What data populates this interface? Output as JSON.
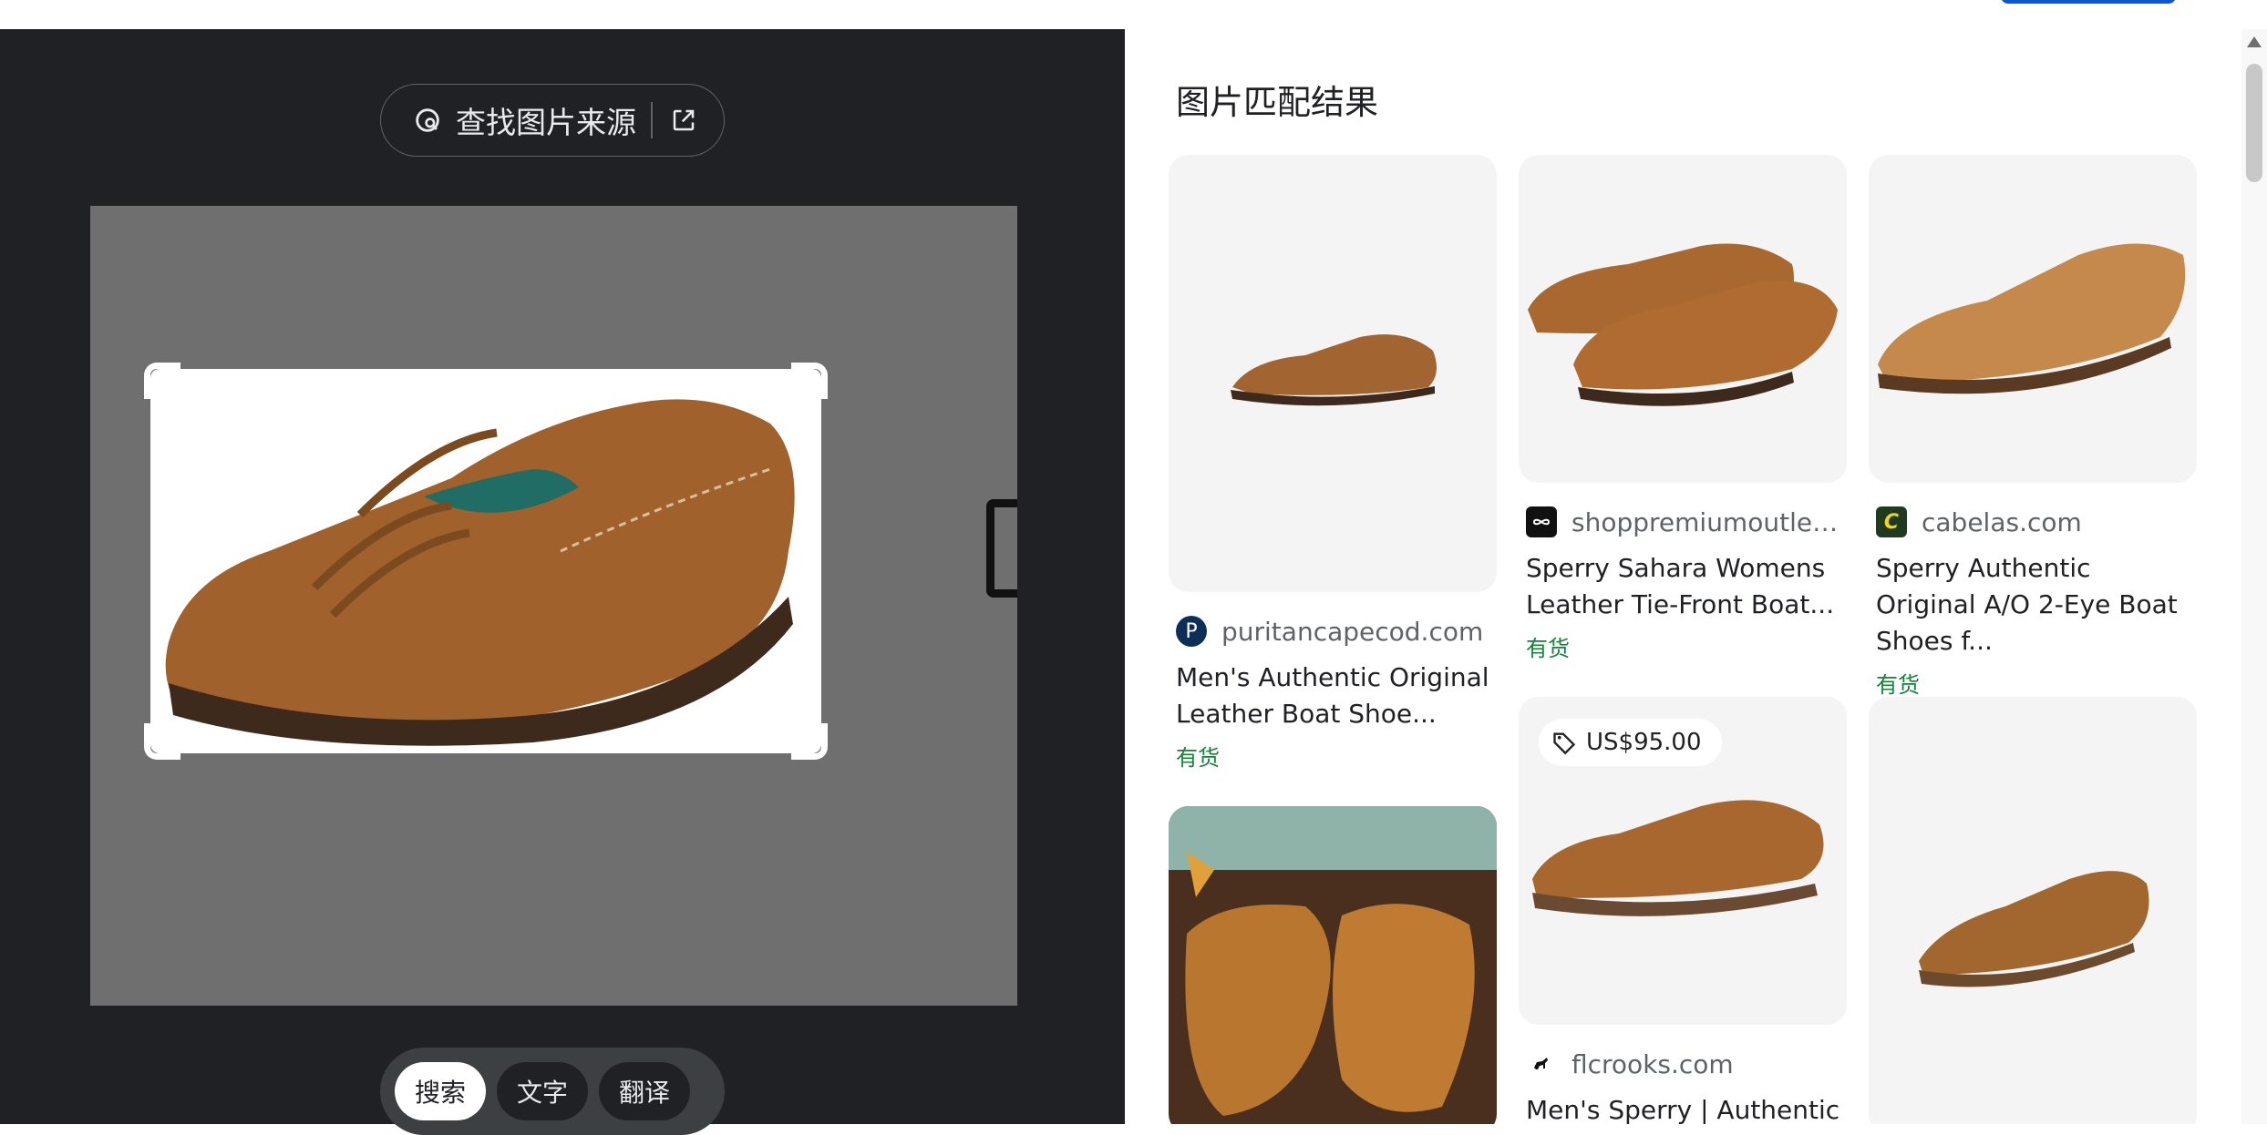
{
  "find_source": {
    "label": "查找图片来源"
  },
  "modes": [
    {
      "label": "搜索",
      "active": true
    },
    {
      "label": "文字",
      "active": false
    },
    {
      "label": "翻译",
      "active": false
    }
  ],
  "results": {
    "title": "图片匹配结果",
    "items": [
      {
        "domain": "puritancapecod.com",
        "title": "Men's Authentic Original Leather Boat Shoe...",
        "stock": "有货",
        "favicon_letter": "P"
      },
      {
        "domain": "shoppremiumoutlets...",
        "title": "Sperry Sahara Womens Leather Tie-Front Boat...",
        "stock": "有货"
      },
      {
        "domain": "cabelas.com",
        "title": "Sperry Authentic Original A/O 2-Eye Boat Shoes f...",
        "stock": "有货",
        "favicon_letter": "C"
      },
      {
        "price": "US$95.00",
        "domain": "flcrooks.com",
        "title": "Men's Sperry | Authentic"
      }
    ]
  },
  "colors": {
    "accent": "#0b57d0",
    "stock_green": "#188038",
    "left_bg": "#202124"
  }
}
